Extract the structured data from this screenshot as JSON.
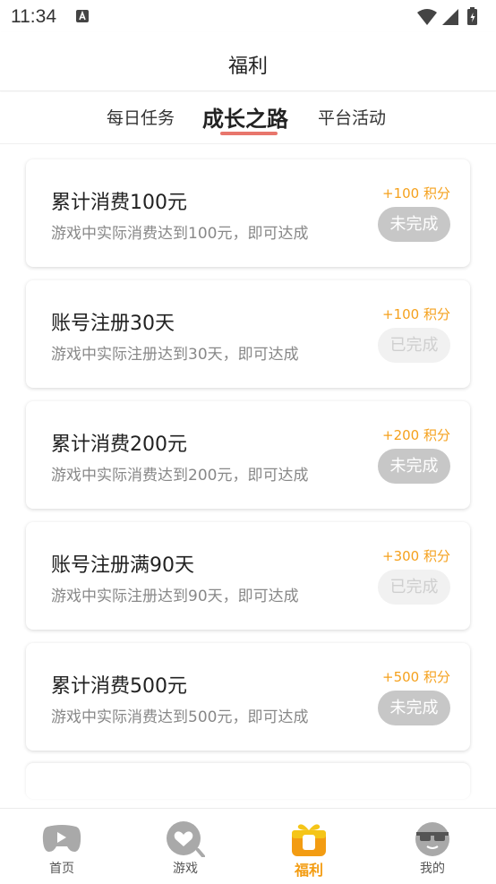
{
  "status_bar": {
    "time": "11:34"
  },
  "header": {
    "title": "福利"
  },
  "tabs": [
    {
      "label": "每日任务"
    },
    {
      "label": "成长之路"
    },
    {
      "label": "平台活动"
    }
  ],
  "tasks": [
    {
      "title": "累计消费100元",
      "desc": "游戏中实际消费达到100元，即可达成",
      "points": "+100 积分",
      "status": "未完成"
    },
    {
      "title": "账号注册30天",
      "desc": "游戏中实际注册达到30天，即可达成",
      "points": "+100 积分",
      "status": "已完成"
    },
    {
      "title": "累计消费200元",
      "desc": "游戏中实际消费达到200元，即可达成",
      "points": "+200 积分",
      "status": "未完成"
    },
    {
      "title": "账号注册满90天",
      "desc": "游戏中实际注册达到90天，即可达成",
      "points": "+300 积分",
      "status": "已完成"
    },
    {
      "title": "累计消费500元",
      "desc": "游戏中实际消费达到500元，即可达成",
      "points": "+500 积分",
      "status": "未完成"
    }
  ],
  "bottom_nav": [
    {
      "label": "首页",
      "icon": "gamepad-icon"
    },
    {
      "label": "游戏",
      "icon": "heart-search-icon"
    },
    {
      "label": "福利",
      "icon": "gift-icon"
    },
    {
      "label": "我的",
      "icon": "sunglasses-face-icon"
    }
  ],
  "colors": {
    "accent": "#f39c12",
    "points": "#f5a11d",
    "tab_underline": "#e8766c",
    "status_pending_bg": "#c7c7c7",
    "status_done_bg": "#f1f1f1"
  }
}
